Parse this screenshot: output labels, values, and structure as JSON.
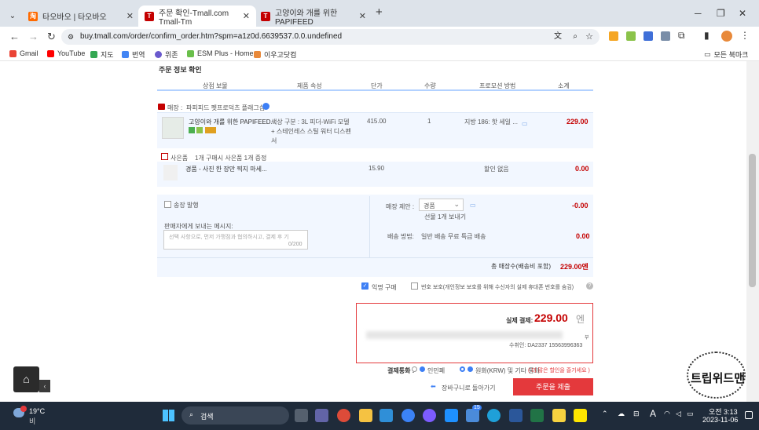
{
  "tabs": [
    {
      "label": "타오바오 | 타오바오",
      "color": "#ff6a00"
    },
    {
      "label": "주문 확인-Tmall.com Tmall-Tm",
      "color": "#c40000"
    },
    {
      "label": "고양이와 개를 위한 PAPIFEED",
      "color": "#c40000"
    }
  ],
  "address": {
    "url": "buy.tmall.com/order/confirm_order.htm?spm=a1z0d.6639537.0.0.undefined"
  },
  "bookmarks": [
    "Gmail",
    "YouTube",
    "지도",
    "번역",
    "위존",
    "ESM Plus - Home",
    "이우고닷컴"
  ],
  "bookmarks_folder": "모든 북마크",
  "order": {
    "section_title": "주문 정보 확인",
    "headers": [
      "상점 보물",
      "제품 속성",
      "단가",
      "수량",
      "프로모션 방법",
      "소계"
    ],
    "shop_label": "매장 :",
    "shop_name": "파피피드 펫프로덕츠 플래그십",
    "item_title": "고양이와 개를 위한 PAPIFEED...",
    "item_attr_1": "색상 구분 : 3L 피더-WiFi 모델",
    "item_attr_2": "+ 스테인레스 스틸 워터 디스펜",
    "item_attr_3": "서",
    "item_price": "415.00",
    "item_qty": "1",
    "item_promo": "지방 186: 핫 세일 ...",
    "item_subtotal": "229.00",
    "gift_label": "사은품",
    "gift_note": "1개 구매시 사은품 1개 증정",
    "gift_item": "경품 - 사진 한 장만 찍지 마세...",
    "gift_price": "15.90",
    "gift_promo": "할인 없음",
    "gift_subtotal": "0.00",
    "invoice_label": "송장 발행",
    "store_discount_label": "매장 제안 :",
    "store_discount_value": "경품",
    "store_discount_note": "선물 1개 보내기",
    "store_discount_amount": "-0.00",
    "message_label": "판매자에게 보내는 메시지:",
    "message_placeholder": "선택 사항으로, 먼저 가맹점과 협의하시고, 결제 후 기",
    "message_counter": "0/200",
    "shipping_label": "배송 방법:",
    "shipping_value": "일반 배송 무료 특급 배송",
    "shipping_amount": "0.00",
    "total_label": "총 매장수(배송비 포함)",
    "total_value": "229.00엔",
    "anon_label": "익명 구매",
    "privacy_label": "번호 보호(개인정보 보호를 위해 수신자의 실제 휴대폰 번호를 숨김)",
    "pay_label": "실제 결제:",
    "pay_value": "229.00",
    "pay_currency": "엔",
    "address_tail": "부",
    "recipient": "수취인: DA2337 15563996363",
    "currency_label": "결제통화 :",
    "currency_cny": "인민폐",
    "currency_krw": "원화(KRW) 및 기타 통화",
    "currency_promo": "( 더 많은 할인을 즐기세요 )",
    "back_link": "장바구니로 돌아가기",
    "submit": "주문을 제출"
  },
  "watermark": "트립위드맨",
  "taskbar": {
    "weather_temp": "19°C",
    "weather_desc": "비",
    "search": "검색",
    "time": "오전 3:13",
    "date": "2023-11-06",
    "badge": "15"
  }
}
